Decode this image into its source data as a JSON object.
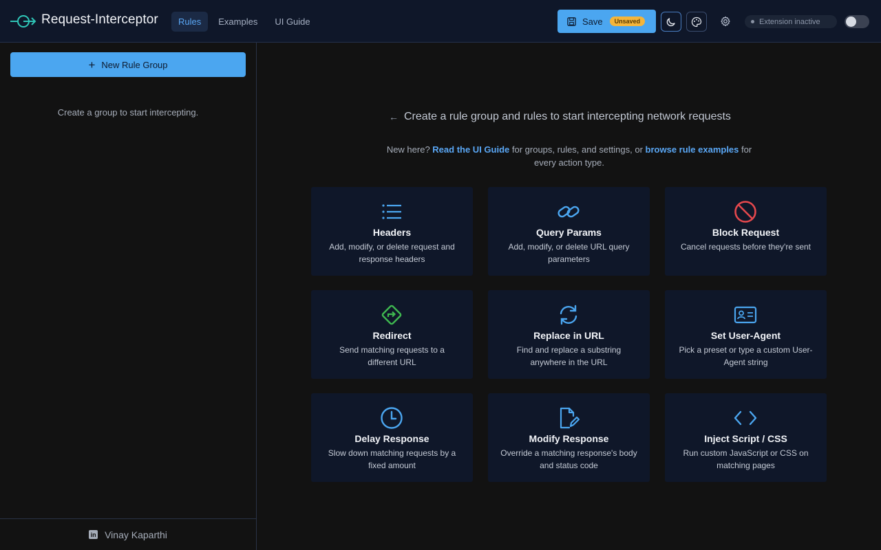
{
  "header": {
    "app_title": "Request-Interceptor",
    "nav": [
      {
        "label": "Rules",
        "active": true
      },
      {
        "label": "Examples",
        "active": false
      },
      {
        "label": "UI Guide",
        "active": false
      }
    ],
    "save_label": "Save",
    "save_badge": "Unsaved",
    "status_text": "Extension inactive",
    "extension_enabled": false
  },
  "sidebar": {
    "new_group_label": "New Rule Group",
    "empty_text": "Create a group to start intercepting.",
    "footer_name": "Vinay Kaparthi"
  },
  "main": {
    "heading": "Create a rule group and rules to start intercepting network requests",
    "sub_prefix": "New here? ",
    "sub_link_guide": "Read the UI Guide",
    "sub_middle": " for groups, rules, and settings, or ",
    "sub_link_examples": "browse rule examples",
    "sub_suffix": " for every action type.",
    "cards": [
      {
        "icon": "list-icon",
        "title": "Headers",
        "desc": "Add, modify, or delete request and response headers"
      },
      {
        "icon": "link-icon",
        "title": "Query Params",
        "desc": "Add, modify, or delete URL query parameters"
      },
      {
        "icon": "block-icon",
        "title": "Block Request",
        "desc": "Cancel requests before they're sent"
      },
      {
        "icon": "redirect-icon",
        "title": "Redirect",
        "desc": "Send matching requests to a different URL"
      },
      {
        "icon": "refresh-icon",
        "title": "Replace in URL",
        "desc": "Find and replace a substring anywhere in the URL"
      },
      {
        "icon": "id-card-icon",
        "title": "Set User-Agent",
        "desc": "Pick a preset or type a custom User-Agent string"
      },
      {
        "icon": "clock-icon",
        "title": "Delay Response",
        "desc": "Slow down matching requests by a fixed amount"
      },
      {
        "icon": "file-edit-icon",
        "title": "Modify Response",
        "desc": "Override a matching response's body and status code"
      },
      {
        "icon": "code-icon",
        "title": "Inject Script / CSS",
        "desc": "Run custom JavaScript or CSS on matching pages"
      }
    ]
  },
  "colors": {
    "accent": "#4ba6f0",
    "link": "#5aa7f5",
    "block_red": "#e5484d",
    "redirect_green": "#3fb950",
    "badge_amber": "#f5b53a"
  }
}
